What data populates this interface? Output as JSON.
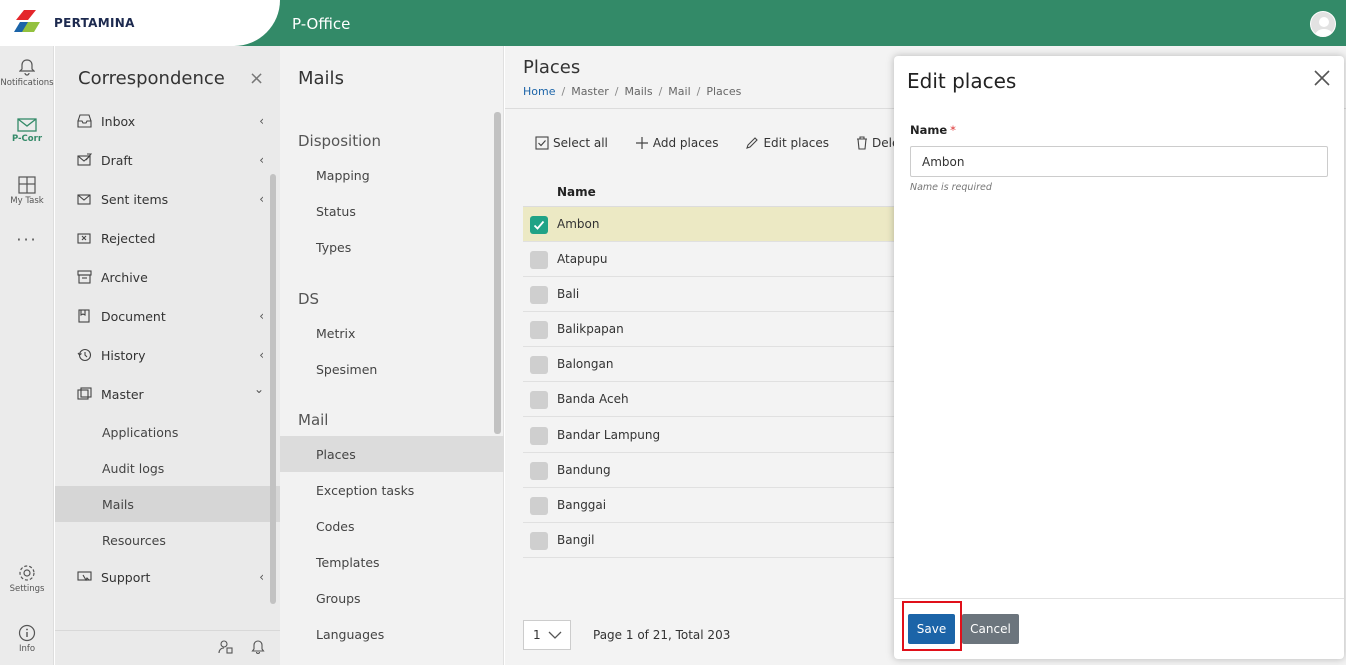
{
  "brand": {
    "logo_text": "PERTAMINA",
    "logo_colors": [
      "#e4262b",
      "#1b64a8",
      "#93c13e"
    ]
  },
  "header": {
    "app_title": "P-Office",
    "accent": "#338a68"
  },
  "rail": {
    "notifications": "Notifications",
    "pcorr": "P-Corr",
    "mytask": "My Task",
    "more": "···",
    "settings": "Settings",
    "info": "Info"
  },
  "correspondence": {
    "title": "Correspondence",
    "close": "×",
    "items": [
      {
        "label": "Inbox",
        "icon": "inbox-icon",
        "chevron": "‹"
      },
      {
        "label": "Draft",
        "icon": "draft-icon",
        "chevron": "‹"
      },
      {
        "label": "Sent items",
        "icon": "sent-icon",
        "chevron": "‹"
      },
      {
        "label": "Rejected",
        "icon": "rejected-icon",
        "chevron": ""
      },
      {
        "label": "Archive",
        "icon": "archive-icon",
        "chevron": ""
      },
      {
        "label": "Document",
        "icon": "document-icon",
        "chevron": "‹"
      },
      {
        "label": "History",
        "icon": "history-icon",
        "chevron": "‹"
      },
      {
        "label": "Master",
        "icon": "master-icon",
        "chevron": "⌄"
      }
    ],
    "master_children": [
      "Applications",
      "Audit logs",
      "Mails",
      "Resources"
    ],
    "support": {
      "label": "Support",
      "icon": "support-icon",
      "chevron": "‹"
    }
  },
  "mails_nav": {
    "title": "Mails",
    "groups": [
      {
        "label": "Disposition",
        "items": [
          "Mapping",
          "Status",
          "Types"
        ]
      },
      {
        "label": "DS",
        "items": [
          "Metrix",
          "Spesimen"
        ]
      },
      {
        "label": "Mail",
        "items": [
          "Places",
          "Exception tasks",
          "Codes",
          "Templates",
          "Groups",
          "Languages"
        ]
      }
    ]
  },
  "page": {
    "title": "Places",
    "breadcrumb": [
      "Home",
      "Master",
      "Mails",
      "Mail",
      "Places"
    ],
    "toolbar": {
      "select_all": "Select all",
      "add": "Add places",
      "edit": "Edit places",
      "delete": "Delete"
    },
    "column_name": "Name",
    "rows": [
      {
        "name": "Ambon",
        "selected": true
      },
      {
        "name": "Atapupu",
        "selected": false
      },
      {
        "name": "Bali",
        "selected": false
      },
      {
        "name": "Balikpapan",
        "selected": false
      },
      {
        "name": "Balongan",
        "selected": false
      },
      {
        "name": "Banda Aceh",
        "selected": false
      },
      {
        "name": "Bandar Lampung",
        "selected": false
      },
      {
        "name": "Bandung",
        "selected": false
      },
      {
        "name": "Banggai",
        "selected": false
      },
      {
        "name": "Bangil",
        "selected": false
      }
    ],
    "pager": {
      "page": "1",
      "summary": "Page 1 of 21, Total 203"
    }
  },
  "dialog": {
    "title": "Edit places",
    "field_label": "Name",
    "required_mark": "*",
    "field_value": "Ambon",
    "hint": "Name is required",
    "save": "Save",
    "cancel": "Cancel"
  }
}
